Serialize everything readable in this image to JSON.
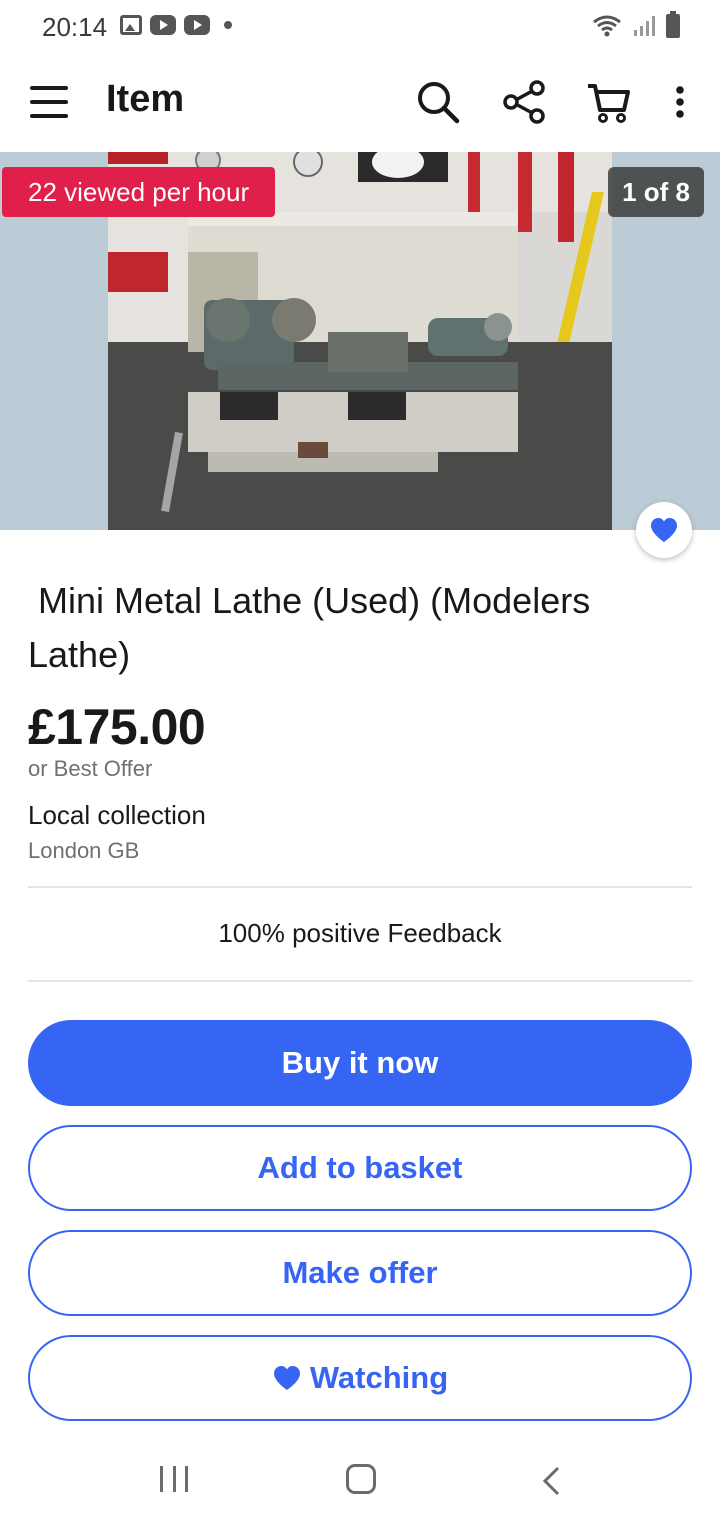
{
  "status_bar": {
    "time": "20:14"
  },
  "header": {
    "title": "Item"
  },
  "gallery": {
    "viewed_badge": "22 viewed per hour",
    "counter": "1 of 8",
    "watched": true
  },
  "item": {
    "title": " Mini Metal Lathe (Used) (Modelers Lathe)",
    "price": "£175.00",
    "best_offer": "or Best Offer",
    "delivery": "Local collection",
    "location": "London GB",
    "feedback": "100% positive Feedback"
  },
  "actions": {
    "buy_now": "Buy it now",
    "add_to_basket": "Add to basket",
    "make_offer": "Make offer",
    "watching": "Watching"
  },
  "colors": {
    "accent": "#3665f3",
    "badge_red": "#e0204a",
    "text": "#191919",
    "muted": "#707070"
  }
}
